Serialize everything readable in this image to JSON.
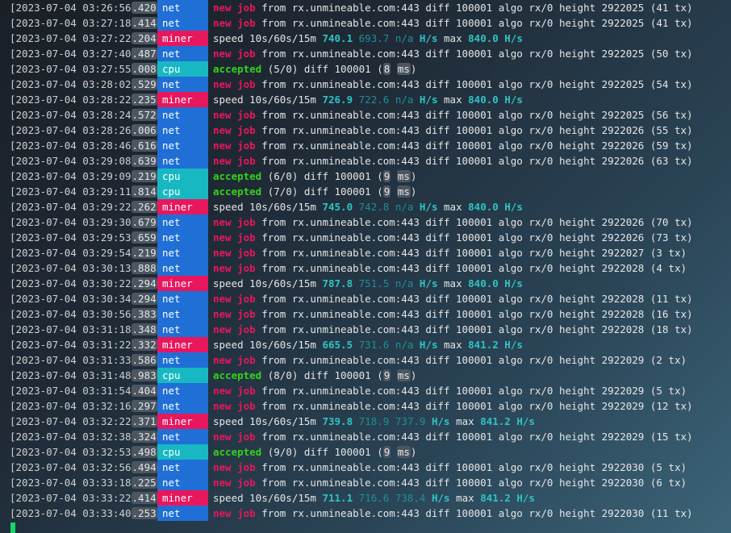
{
  "terminal": {
    "lines": [
      {
        "ts": "[2023-07-04 03:26:56",
        "ms": ".420",
        "end": "]",
        "tag": "net",
        "kind": "job",
        "host": "rx.unmineable.com:443",
        "diff": "100001",
        "algo": "rx/0",
        "height": "2922025",
        "tx": "(41 tx)"
      },
      {
        "ts": "[2023-07-04 03:27:18",
        "ms": ".414",
        "end": "]",
        "tag": "net",
        "kind": "job",
        "host": "rx.unmineable.com:443",
        "diff": "100001",
        "algo": "rx/0",
        "height": "2922025",
        "tx": "(41 tx)"
      },
      {
        "ts": "[2023-07-04 03:27:22",
        "ms": ".204",
        "end": "]",
        "tag": "miner",
        "kind": "speed",
        "s1": "740.1",
        "s2": "693.7",
        "s3": "n/a",
        "max": "840.0"
      },
      {
        "ts": "[2023-07-04 03:27:40",
        "ms": ".487",
        "end": "]",
        "tag": "net",
        "kind": "job",
        "host": "rx.unmineable.com:443",
        "diff": "100001",
        "algo": "rx/0",
        "height": "2922025",
        "tx": "(50 tx)"
      },
      {
        "ts": "[2023-07-04 03:27:55",
        "ms": ".008",
        "end": "]",
        "tag": "cpu",
        "kind": "accepted",
        "count": "(5/0)",
        "diff": "100001",
        "time": "8"
      },
      {
        "ts": "[2023-07-04 03:28:02",
        "ms": ".529",
        "end": "]",
        "tag": "net",
        "kind": "job",
        "host": "rx.unmineable.com:443",
        "diff": "100001",
        "algo": "rx/0",
        "height": "2922025",
        "tx": "(54 tx)"
      },
      {
        "ts": "[2023-07-04 03:28:22",
        "ms": ".235",
        "end": "]",
        "tag": "miner",
        "kind": "speed",
        "s1": "726.9",
        "s2": "722.6",
        "s3": "n/a",
        "max": "840.0"
      },
      {
        "ts": "[2023-07-04 03:28:24",
        "ms": ".572",
        "end": "]",
        "tag": "net",
        "kind": "job",
        "host": "rx.unmineable.com:443",
        "diff": "100001",
        "algo": "rx/0",
        "height": "2922025",
        "tx": "(56 tx)"
      },
      {
        "ts": "[2023-07-04 03:28:26",
        "ms": ".006",
        "end": "]",
        "tag": "net",
        "kind": "job",
        "host": "rx.unmineable.com:443",
        "diff": "100001",
        "algo": "rx/0",
        "height": "2922026",
        "tx": "(55 tx)"
      },
      {
        "ts": "[2023-07-04 03:28:46",
        "ms": ".616",
        "end": "]",
        "tag": "net",
        "kind": "job",
        "host": "rx.unmineable.com:443",
        "diff": "100001",
        "algo": "rx/0",
        "height": "2922026",
        "tx": "(59 tx)"
      },
      {
        "ts": "[2023-07-04 03:29:08",
        "ms": ".639",
        "end": "]",
        "tag": "net",
        "kind": "job",
        "host": "rx.unmineable.com:443",
        "diff": "100001",
        "algo": "rx/0",
        "height": "2922026",
        "tx": "(63 tx)"
      },
      {
        "ts": "[2023-07-04 03:29:09",
        "ms": ".219",
        "end": "]",
        "tag": "cpu",
        "kind": "accepted",
        "count": "(6/0)",
        "diff": "100001",
        "time": "9"
      },
      {
        "ts": "[2023-07-04 03:29:11",
        "ms": ".814",
        "end": "]",
        "tag": "cpu",
        "kind": "accepted",
        "count": "(7/0)",
        "diff": "100001",
        "time": "9"
      },
      {
        "ts": "[2023-07-04 03:29:22",
        "ms": ".262",
        "end": "]",
        "tag": "miner",
        "kind": "speed",
        "s1": "745.0",
        "s2": "742.8",
        "s3": "n/a",
        "max": "840.0"
      },
      {
        "ts": "[2023-07-04 03:29:30",
        "ms": ".679",
        "end": "]",
        "tag": "net",
        "kind": "job",
        "host": "rx.unmineable.com:443",
        "diff": "100001",
        "algo": "rx/0",
        "height": "2922026",
        "tx": "(70 tx)"
      },
      {
        "ts": "[2023-07-04 03:29:53",
        "ms": ".659",
        "end": "]",
        "tag": "net",
        "kind": "job",
        "host": "rx.unmineable.com:443",
        "diff": "100001",
        "algo": "rx/0",
        "height": "2922026",
        "tx": "(73 tx)"
      },
      {
        "ts": "[2023-07-04 03:29:54",
        "ms": ".219",
        "end": "]",
        "tag": "net",
        "kind": "job",
        "host": "rx.unmineable.com:443",
        "diff": "100001",
        "algo": "rx/0",
        "height": "2922027",
        "tx": "(3 tx)"
      },
      {
        "ts": "[2023-07-04 03:30:13",
        "ms": ".888",
        "end": "]",
        "tag": "net",
        "kind": "job",
        "host": "rx.unmineable.com:443",
        "diff": "100001",
        "algo": "rx/0",
        "height": "2922028",
        "tx": "(4 tx)"
      },
      {
        "ts": "[2023-07-04 03:30:22",
        "ms": ".294",
        "end": "]",
        "tag": "miner",
        "kind": "speed",
        "s1": "787.8",
        "s2": "751.5",
        "s3": "n/a",
        "max": "840.0"
      },
      {
        "ts": "[2023-07-04 03:30:34",
        "ms": ".294",
        "end": "]",
        "tag": "net",
        "kind": "job",
        "host": "rx.unmineable.com:443",
        "diff": "100001",
        "algo": "rx/0",
        "height": "2922028",
        "tx": "(11 tx)"
      },
      {
        "ts": "[2023-07-04 03:30:56",
        "ms": ".383",
        "end": "]",
        "tag": "net",
        "kind": "job",
        "host": "rx.unmineable.com:443",
        "diff": "100001",
        "algo": "rx/0",
        "height": "2922028",
        "tx": "(16 tx)"
      },
      {
        "ts": "[2023-07-04 03:31:18",
        "ms": ".348",
        "end": "]",
        "tag": "net",
        "kind": "job",
        "host": "rx.unmineable.com:443",
        "diff": "100001",
        "algo": "rx/0",
        "height": "2922028",
        "tx": "(18 tx)"
      },
      {
        "ts": "[2023-07-04 03:31:22",
        "ms": ".332",
        "end": "]",
        "tag": "miner",
        "kind": "speed",
        "s1": "665.5",
        "s2": "731.6",
        "s3": "n/a",
        "max": "841.2"
      },
      {
        "ts": "[2023-07-04 03:31:33",
        "ms": ".586",
        "end": "]",
        "tag": "net",
        "kind": "job",
        "host": "rx.unmineable.com:443",
        "diff": "100001",
        "algo": "rx/0",
        "height": "2922029",
        "tx": "(2 tx)"
      },
      {
        "ts": "[2023-07-04 03:31:48",
        "ms": ".983",
        "end": "]",
        "tag": "cpu",
        "kind": "accepted",
        "count": "(8/0)",
        "diff": "100001",
        "time": "9"
      },
      {
        "ts": "[2023-07-04 03:31:54",
        "ms": ".404",
        "end": "]",
        "tag": "net",
        "kind": "job",
        "host": "rx.unmineable.com:443",
        "diff": "100001",
        "algo": "rx/0",
        "height": "2922029",
        "tx": "(5 tx)"
      },
      {
        "ts": "[2023-07-04 03:32:16",
        "ms": ".297",
        "end": "]",
        "tag": "net",
        "kind": "job",
        "host": "rx.unmineable.com:443",
        "diff": "100001",
        "algo": "rx/0",
        "height": "2922029",
        "tx": "(12 tx)"
      },
      {
        "ts": "[2023-07-04 03:32:22",
        "ms": ".371",
        "end": "]",
        "tag": "miner",
        "kind": "speed",
        "s1": "739.8",
        "s2": "718.9",
        "s3": "737.9",
        "max": "841.2"
      },
      {
        "ts": "[2023-07-04 03:32:38",
        "ms": ".324",
        "end": "]",
        "tag": "net",
        "kind": "job",
        "host": "rx.unmineable.com:443",
        "diff": "100001",
        "algo": "rx/0",
        "height": "2922029",
        "tx": "(15 tx)"
      },
      {
        "ts": "[2023-07-04 03:32:53",
        "ms": ".498",
        "end": "]",
        "tag": "cpu",
        "kind": "accepted",
        "count": "(9/0)",
        "diff": "100001",
        "time": "9"
      },
      {
        "ts": "[2023-07-04 03:32:56",
        "ms": ".494",
        "end": "]",
        "tag": "net",
        "kind": "job",
        "host": "rx.unmineable.com:443",
        "diff": "100001",
        "algo": "rx/0",
        "height": "2922030",
        "tx": "(5 tx)"
      },
      {
        "ts": "[2023-07-04 03:33:18",
        "ms": ".225",
        "end": "]",
        "tag": "net",
        "kind": "job",
        "host": "rx.unmineable.com:443",
        "diff": "100001",
        "algo": "rx/0",
        "height": "2922030",
        "tx": "(6 tx)"
      },
      {
        "ts": "[2023-07-04 03:33:22",
        "ms": ".414",
        "end": "]",
        "tag": "miner",
        "kind": "speed",
        "s1": "711.1",
        "s2": "716.6",
        "s3": "738.4",
        "max": "841.2"
      },
      {
        "ts": "[2023-07-04 03:33:40",
        "ms": ".253",
        "end": "]",
        "tag": "net",
        "kind": "job",
        "host": "rx.unmineable.com:443",
        "diff": "100001",
        "algo": "rx/0",
        "height": "2922030",
        "tx": "(11 tx)"
      }
    ],
    "words": {
      "new": "new",
      "job": "job",
      "from": "from",
      "diff": "diff",
      "algo": "algo",
      "height": "height",
      "accepted": "accepted",
      "speed": "speed 10s/60s/15m",
      "hs": "H/s",
      "max": "max",
      "ms": "ms"
    },
    "colors": {
      "net": "#1f6fd6",
      "cpu": "#17b8c2",
      "miner": "#e8175d",
      "accepted": "#36d11b",
      "cursor": "#16d46a"
    }
  }
}
